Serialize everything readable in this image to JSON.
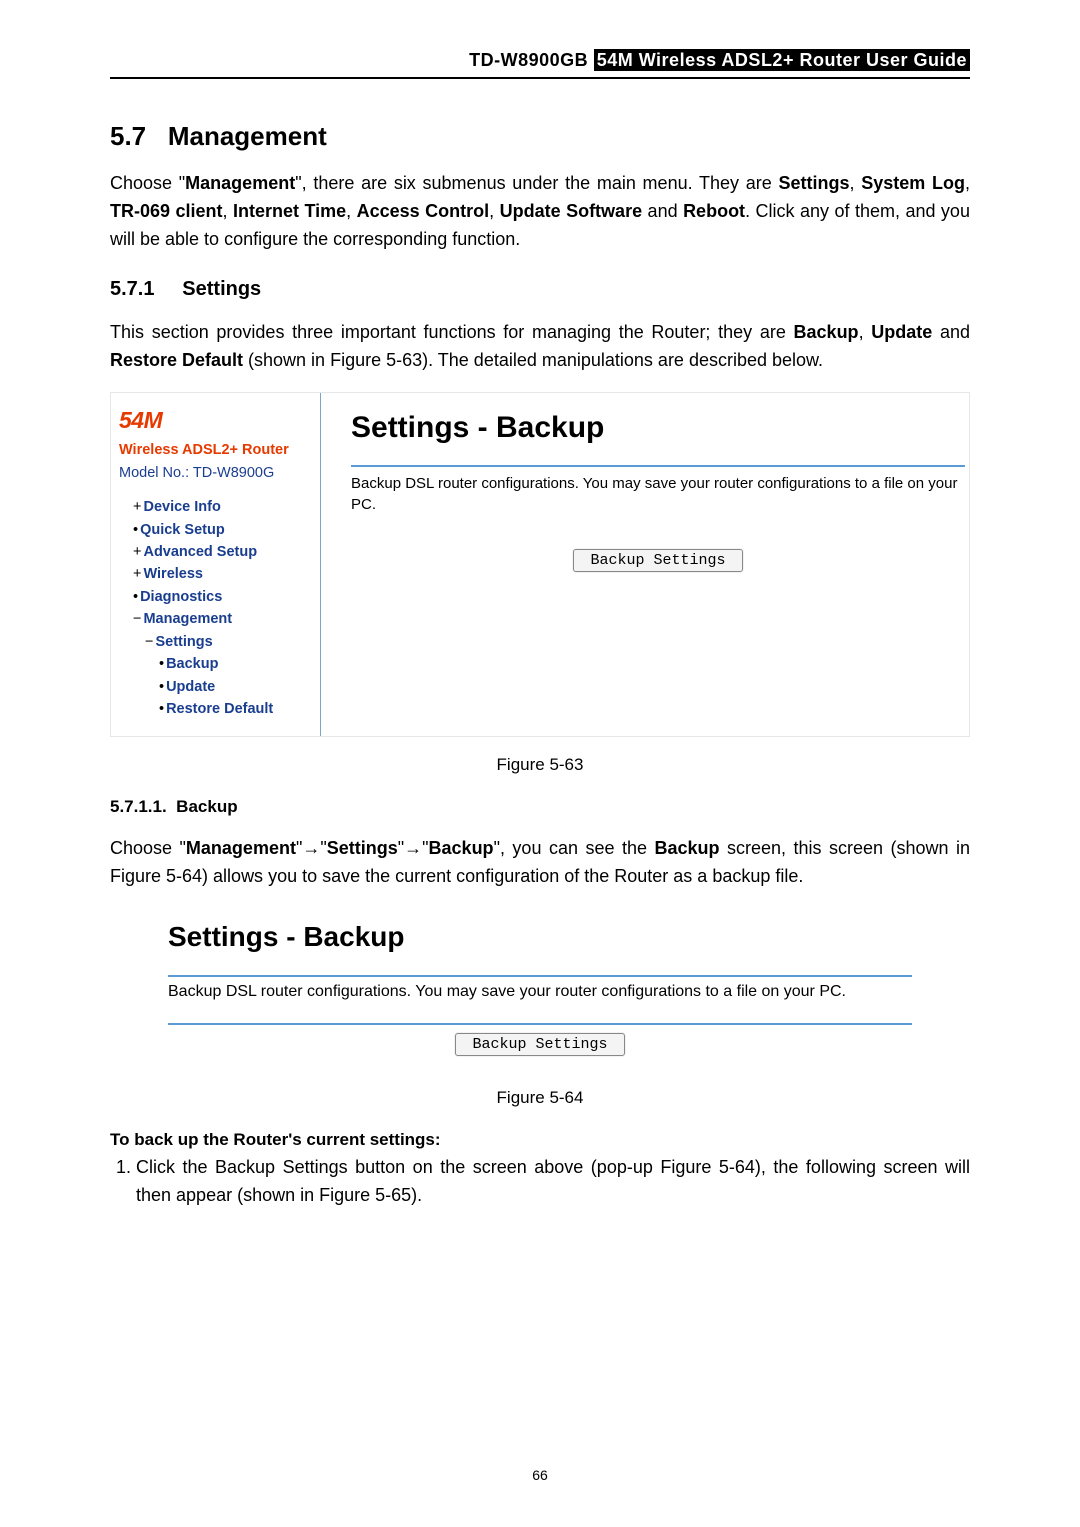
{
  "header": {
    "model": "TD-W8900GB",
    "title_inv": "54M  Wireless  ADSL2+  Router  User  Guide"
  },
  "section": {
    "number": "5.7",
    "title": "Management"
  },
  "intro": {
    "pre": "Choose \"",
    "mgmt": "Management",
    "mid1": "\", there are six submenus under the main menu. They are ",
    "s1": "Settings",
    "c1": ", ",
    "s2": "System Log",
    "c2": ", ",
    "s3": "TR-069 client",
    "c3": ", ",
    "s4": "Internet Time",
    "c4": ", ",
    "s5": "Access Control",
    "c5": ", ",
    "s6": "Update Software",
    "c6": " and ",
    "s7": "Reboot",
    "tail": ". Click any of them, and you will be able to configure the corresponding function."
  },
  "subsection": {
    "number": "5.7.1",
    "title": "Settings"
  },
  "settings_text": {
    "pre": "This section provides three important functions for managing the Router; they are ",
    "b1": "Backup",
    "c1": ", ",
    "b2": "Update",
    "c2": " and ",
    "b3": "Restore Default",
    "tail": " (shown in Figure 5-63). The detailed manipulations are described below."
  },
  "router_ui": {
    "brand": "54M",
    "brand_sub": "Wireless ADSL2+ Router",
    "model_label": "Model No.: ",
    "model_value": "TD-W8900G",
    "nav": {
      "n0": "Device Info",
      "n1": "Quick Setup",
      "n2": "Advanced Setup",
      "n3": "Wireless",
      "n4": "Diagnostics",
      "n5": "Management",
      "n6": "Settings",
      "n7": "Backup",
      "n8": "Update",
      "n9": "Restore Default"
    },
    "main_title": "Settings - Backup",
    "main_desc": "Backup DSL router configurations. You may save your router configurations to a file on your PC.",
    "button": "Backup Settings"
  },
  "fig63": "Figure 5-63",
  "subsub": {
    "number": "5.7.1.1.",
    "title": "Backup"
  },
  "backup_text": {
    "pre": "Choose \"",
    "p1": "Management",
    "a1": "\"→\"",
    "p2": "Settings",
    "a2": "\"→\"",
    "p3": "Backup",
    "mid": "\", you can see the ",
    "b1": "Backup",
    "tail": " screen, this screen (shown in Figure 5-64) allows you to save the current configuration of the Router as a backup file."
  },
  "router_ui2": {
    "title": "Settings - Backup",
    "desc": "Backup DSL router configurations. You may save your router configurations to a file on your PC.",
    "button": "Backup Settings"
  },
  "fig64": "Figure 5-64",
  "steps_head": "To back up the Router's current settings:",
  "step1": {
    "pre": "Click the ",
    "b1": "Backup Settings",
    "tail": " button on the screen above (pop-up Figure 5-64), the following screen will then appear (shown in Figure 5-65)."
  },
  "page_number": "66"
}
